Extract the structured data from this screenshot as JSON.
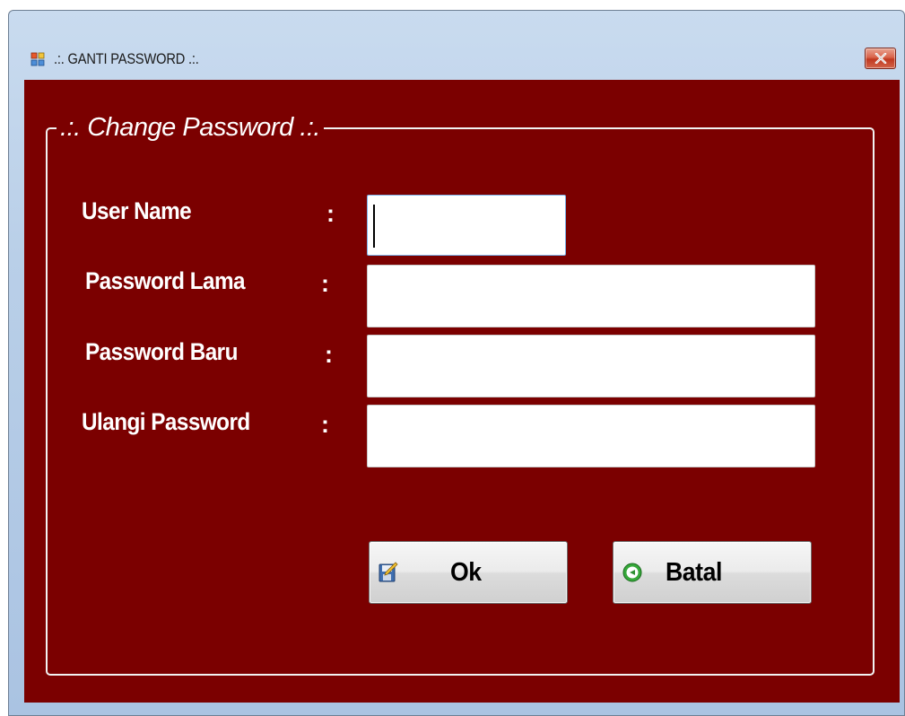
{
  "window": {
    "title": ".:. GANTI PASSWORD .:.",
    "icon": "app-window-icon",
    "close_icon": "close-icon"
  },
  "group": {
    "title": ".:. Change Password .:."
  },
  "form": {
    "fields": [
      {
        "label": "User Name",
        "colon": ":",
        "value": "",
        "focused": true
      },
      {
        "label": "Password Lama",
        "colon": ":",
        "value": ""
      },
      {
        "label": "Password Baru",
        "colon": ":",
        "value": ""
      },
      {
        "label": "Ulangi Password",
        "colon": ":",
        "value": ""
      }
    ]
  },
  "buttons": {
    "ok_label": "Ok",
    "ok_icon": "save-edit-icon",
    "cancel_label": "Batal",
    "cancel_icon": "back-arrow-icon"
  },
  "colors": {
    "client_background": "#7b0000",
    "text": "#ffffff",
    "close_button": "#c9472e"
  }
}
